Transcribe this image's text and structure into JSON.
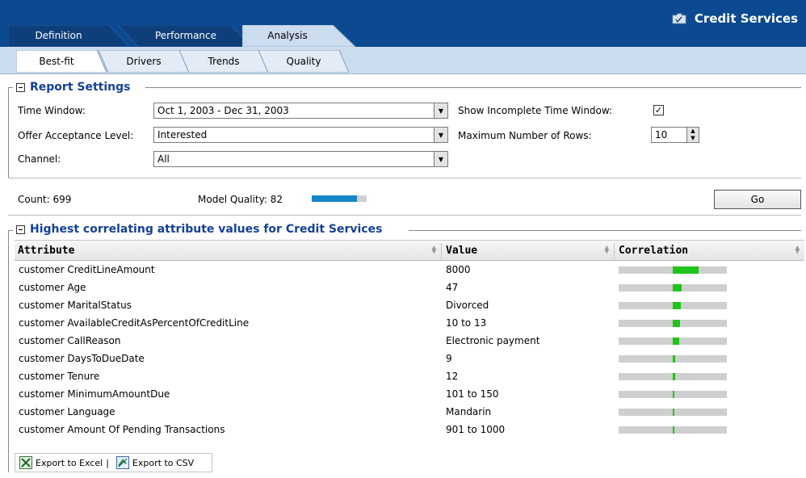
{
  "header": {
    "app_title": "Credit Services",
    "main_tabs": [
      {
        "label": "Definition",
        "active": false
      },
      {
        "label": "Performance",
        "active": false
      },
      {
        "label": "Analysis",
        "active": true
      }
    ],
    "sub_tabs": [
      {
        "label": "Best-fit",
        "active": true
      },
      {
        "label": "Drivers",
        "active": false
      },
      {
        "label": "Trends",
        "active": false
      },
      {
        "label": "Quality",
        "active": false
      }
    ]
  },
  "report_settings": {
    "title": "Report Settings",
    "time_window_label": "Time Window:",
    "time_window_value": "Oct 1, 2003 - Dec 31, 2003",
    "offer_label": "Offer Acceptance Level:",
    "offer_value": "Interested",
    "channel_label": "Channel:",
    "channel_value": "All",
    "incomplete_label": "Show Incomplete Time Window:",
    "incomplete_checked": true,
    "incomplete_check_glyph": "✓",
    "max_rows_label": "Maximum Number of Rows:",
    "max_rows_value": "10",
    "count_text": "Count: 699",
    "model_quality_text": "Model Quality: 82",
    "model_quality_value": 82,
    "go_label": "Go"
  },
  "results": {
    "title": "Highest correlating attribute values for Credit Services",
    "columns": [
      "Attribute",
      "Value",
      "Correlation"
    ],
    "rows": [
      {
        "attribute": "customer CreditLineAmount",
        "value": "8000",
        "correlation": 0.25
      },
      {
        "attribute": "customer Age",
        "value": "47",
        "correlation": 0.09
      },
      {
        "attribute": "customer MaritalStatus",
        "value": "Divorced",
        "correlation": 0.08
      },
      {
        "attribute": "customer AvailableCreditAsPercentOfCreditLine",
        "value": "10 to 13",
        "correlation": 0.07
      },
      {
        "attribute": "customer CallReason",
        "value": "Electronic payment",
        "correlation": 0.06
      },
      {
        "attribute": "customer DaysToDueDate",
        "value": "9",
        "correlation": 0.02
      },
      {
        "attribute": "customer Tenure",
        "value": "12",
        "correlation": 0.02
      },
      {
        "attribute": "customer MinimumAmountDue",
        "value": "101 to 150",
        "correlation": 0.015
      },
      {
        "attribute": "customer Language",
        "value": "Mandarin",
        "correlation": 0.015
      },
      {
        "attribute": "customer Amount Of Pending Transactions",
        "value": "901 to 1000",
        "correlation": 0.015
      }
    ]
  },
  "footer": {
    "export_excel": "Export to Excel",
    "separator": "|",
    "export_csv": "Export to CSV"
  },
  "colors": {
    "header_blue": "#0b4a90",
    "subtab_band": "#ccdcef",
    "section_title": "#14409a",
    "quality_fill": "#1686c4",
    "correlation_fill": "#1ec418"
  }
}
